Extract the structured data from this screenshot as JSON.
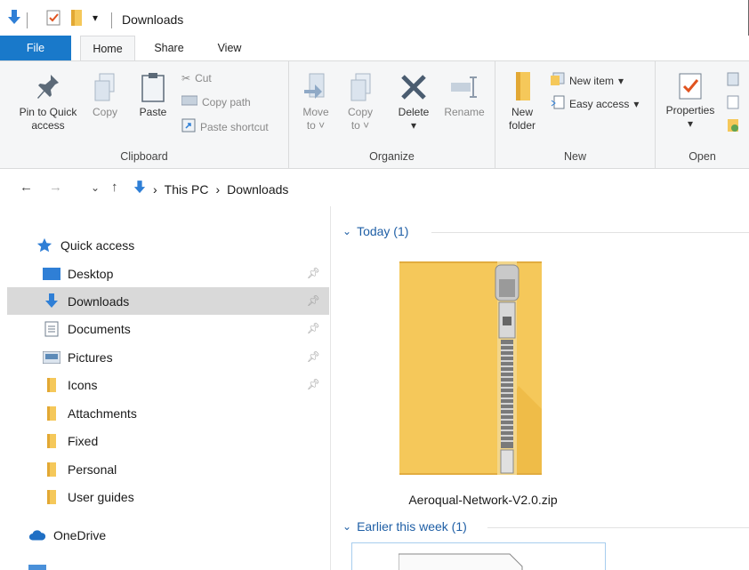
{
  "window": {
    "title": "Downloads"
  },
  "ribbon_tabs": [
    {
      "label": "File"
    },
    {
      "label": "Home"
    },
    {
      "label": "Share"
    },
    {
      "label": "View"
    }
  ],
  "ribbon": {
    "clipboard": {
      "label": "Clipboard",
      "pin": "Pin to Quick access",
      "copy": "Copy",
      "paste": "Paste",
      "cut": "Cut",
      "copy_path": "Copy path",
      "paste_shortcut": "Paste shortcut"
    },
    "organize": {
      "label": "Organize",
      "move_to": "Move to",
      "copy_to": "Copy to",
      "delete": "Delete",
      "rename": "Rename"
    },
    "new": {
      "label": "New",
      "new_folder": "New folder",
      "new_item": "New item",
      "easy_access": "Easy access"
    },
    "open": {
      "label": "Open",
      "properties": "Properties"
    }
  },
  "address": {
    "crumbs": [
      "This PC",
      "Downloads"
    ]
  },
  "nav_pane": {
    "quick_access": "Quick access",
    "items": [
      {
        "label": "Desktop",
        "icon": "desktop-icon",
        "pinned": true
      },
      {
        "label": "Downloads",
        "icon": "downloads-icon",
        "pinned": true,
        "selected": true
      },
      {
        "label": "Documents",
        "icon": "documents-icon",
        "pinned": true
      },
      {
        "label": "Pictures",
        "icon": "pictures-icon",
        "pinned": true
      },
      {
        "label": "Icons",
        "icon": "folder-icon",
        "pinned": true
      },
      {
        "label": "Attachments",
        "icon": "folder-icon",
        "pinned": false
      },
      {
        "label": "Fixed",
        "icon": "folder-icon",
        "pinned": false
      },
      {
        "label": "Personal",
        "icon": "folder-icon",
        "pinned": false
      },
      {
        "label": "User guides",
        "icon": "folder-icon",
        "pinned": false
      }
    ],
    "onedrive": "OneDrive"
  },
  "content": {
    "groups": [
      {
        "header": "Today (1)",
        "files": [
          {
            "name": "Aeroqual-Network-V2.0.zip",
            "icon": "zip-folder-icon"
          }
        ]
      },
      {
        "header": "Earlier this week (1)"
      }
    ]
  },
  "colors": {
    "accent": "#1979ca",
    "folder": "#f5c85a",
    "link": "#1f5fa6",
    "selected_bg": "#d9d9d9"
  }
}
